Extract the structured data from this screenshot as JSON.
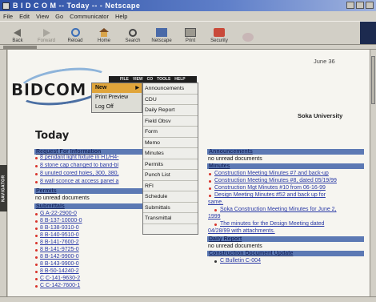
{
  "window": {
    "title": "B I D C O M -- Today -- - Netscape"
  },
  "menubar": [
    "File",
    "Edit",
    "View",
    "Go",
    "Communicator",
    "Help"
  ],
  "toolbar": [
    {
      "label": "Back",
      "icon": "back-icon",
      "enabled": true
    },
    {
      "label": "Forward",
      "icon": "forward-icon",
      "enabled": false
    },
    {
      "label": "Reload",
      "icon": "reload-icon",
      "enabled": true
    },
    {
      "label": "Home",
      "icon": "home-icon",
      "enabled": true
    },
    {
      "label": "Search",
      "icon": "search-icon",
      "enabled": true
    },
    {
      "label": "Netscape",
      "icon": "netscape-icon",
      "enabled": true
    },
    {
      "label": "Print",
      "icon": "print-icon",
      "enabled": true
    },
    {
      "label": "Security",
      "icon": "security-icon",
      "enabled": true
    },
    {
      "label": "",
      "icon": "stop-icon",
      "enabled": false
    }
  ],
  "navigator_tab": "NAVIGATOR",
  "page": {
    "date": "June 36",
    "logo": "BIDCOM",
    "school": "Soka University",
    "title": "Today",
    "top_menu": [
      "FILE",
      "VIEW",
      "CO",
      "TOOLS",
      "HELP"
    ],
    "file_menu": [
      {
        "label": "New",
        "active": true,
        "has_submenu": true
      },
      {
        "label": "Print Preview",
        "active": false
      },
      {
        "label": "Log Off",
        "active": false
      }
    ],
    "new_submenu": [
      "Announcements",
      "CDU",
      "Daily Report",
      "Field Obsv",
      "Form",
      "Memo",
      "Minutes",
      "Permits",
      "Punch List",
      "RFI",
      "Schedule",
      "Submittals",
      "Transmittal"
    ],
    "left": {
      "rfi_header": "Request For Information",
      "rfi_items": [
        "8 pendant light fixture in H1/H4-",
        "8 stone cap changed to band-bl",
        "8 unuted cored holes, 300, 380,",
        "8 wall sconce at access panel a"
      ],
      "permits_header": "Permits",
      "permits_text": "no unread documents",
      "submittals_header": "Submittals",
      "submittals_items": [
        "G A-22-2900-0",
        "8 B-137-10000-0",
        "8 B-138-9310-0",
        "8 B-140-9510-0",
        "8 B-141-7600-2",
        "8 B-141-9725-0",
        "8 B-142-9900-0",
        "8 B-143-9900-0",
        "8 B-50-14240-2",
        "C C-141-9630-2",
        "C C-142-7600-1"
      ]
    },
    "right": {
      "announcements_header": "Announcements",
      "announcements_text": "no unread documents",
      "minutes_header": "Minutes",
      "minutes_items": [
        [
          "Construction Meeting Minutes #7 and back-up"
        ],
        [
          "Construction Meeting Minutes #8, dated 05/19/99"
        ],
        [
          "Construction Mgt Minutes #10 from 06-16-99"
        ],
        [
          "Design Meeting Minutes #52 and back up for",
          "same."
        ],
        [
          "Soka Construction Meeting Minutes for June 2,",
          "1999"
        ],
        [
          "The minutes for the Design Meeting dated",
          "04/28/99 with attachments."
        ]
      ],
      "daily_header": "Daily Report",
      "daily_text": "no unread documents",
      "cdu_header": "Construction Document Update",
      "cdu_items": [
        "C Bulletin C-004"
      ]
    }
  }
}
